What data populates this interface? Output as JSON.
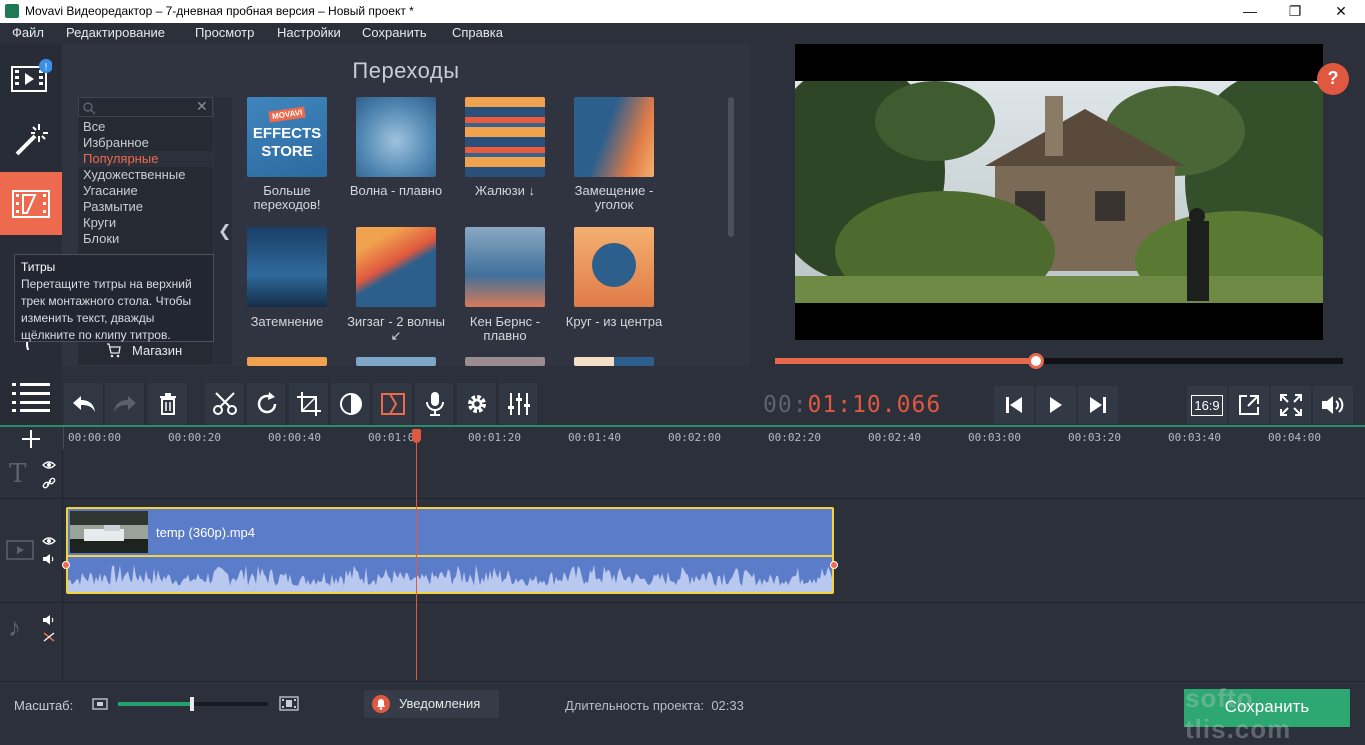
{
  "window": {
    "title": "Movavi Видеоредактор – 7-дневная пробная версия – Новый проект *",
    "controls": [
      "minimize",
      "maximize",
      "close"
    ]
  },
  "menu": [
    "Файл",
    "Редактирование",
    "Просмотр",
    "Настройки",
    "Сохранить",
    "Справка"
  ],
  "sidebar": {
    "items": [
      {
        "name": "import-media",
        "icon": "film-import-icon",
        "badge": "!"
      },
      {
        "name": "filters",
        "icon": "magic-wand-icon"
      },
      {
        "name": "transitions",
        "icon": "transition-icon",
        "active": true
      },
      {
        "name": "titles",
        "icon": "titles-icon"
      },
      {
        "name": "stickers",
        "icon": "stickers-icon"
      },
      {
        "name": "more",
        "icon": "list-icon"
      }
    ]
  },
  "tooltip": {
    "title": "Титры",
    "text": "Перетащите титры на верхний трек монтажного стола. Чтобы изменить текст, дважды щёлкните по клипу титров."
  },
  "transitions_panel": {
    "title": "Переходы",
    "search_placeholder": "",
    "categories": [
      "Все",
      "Избранное",
      "Популярные",
      "Художественные",
      "Угасание",
      "Размытие",
      "Круги",
      "Блоки"
    ],
    "selected_category": "Популярные",
    "store_label": "Магазин",
    "store_tile": {
      "line1": "MOVAVI",
      "line2": "EFFECTS",
      "line3": "STORE"
    },
    "tiles": [
      {
        "label": "Больше переходов!"
      },
      {
        "label": "Волна - плавно"
      },
      {
        "label": "Жалюзи ↓"
      },
      {
        "label": "Замещение - уголок"
      },
      {
        "label": "Затемнение"
      },
      {
        "label": "Зигзаг - 2 волны ↙"
      },
      {
        "label": "Кен Бернс - плавно"
      },
      {
        "label": "Круг - из центра"
      }
    ]
  },
  "player": {
    "help": "?",
    "progress": 0.459,
    "timecode_dim": "00:",
    "timecode_main": "01:10.066",
    "aspect": "16:9"
  },
  "timeline": {
    "ticks": [
      "00:00:00",
      "00:00:20",
      "00:00:40",
      "00:01:00",
      "00:01:20",
      "00:01:40",
      "00:02:00",
      "00:02:20",
      "00:02:40",
      "00:03:00",
      "00:03:20",
      "00:03:40",
      "00:04:00"
    ],
    "clip_name": "temp (360p).mp4"
  },
  "status": {
    "zoom_label": "Масштаб:",
    "zoom_level": 0.48,
    "notifications": "Уведомления",
    "duration_label": "Длительность проекта:",
    "duration_value": "02:33",
    "save": "Сохранить",
    "watermark": "softo tlis.com"
  },
  "colors": {
    "accent": "#ee6a4e",
    "save": "#2ea873",
    "clip": "#5b7cc8",
    "clip_border": "#f4d23b"
  }
}
